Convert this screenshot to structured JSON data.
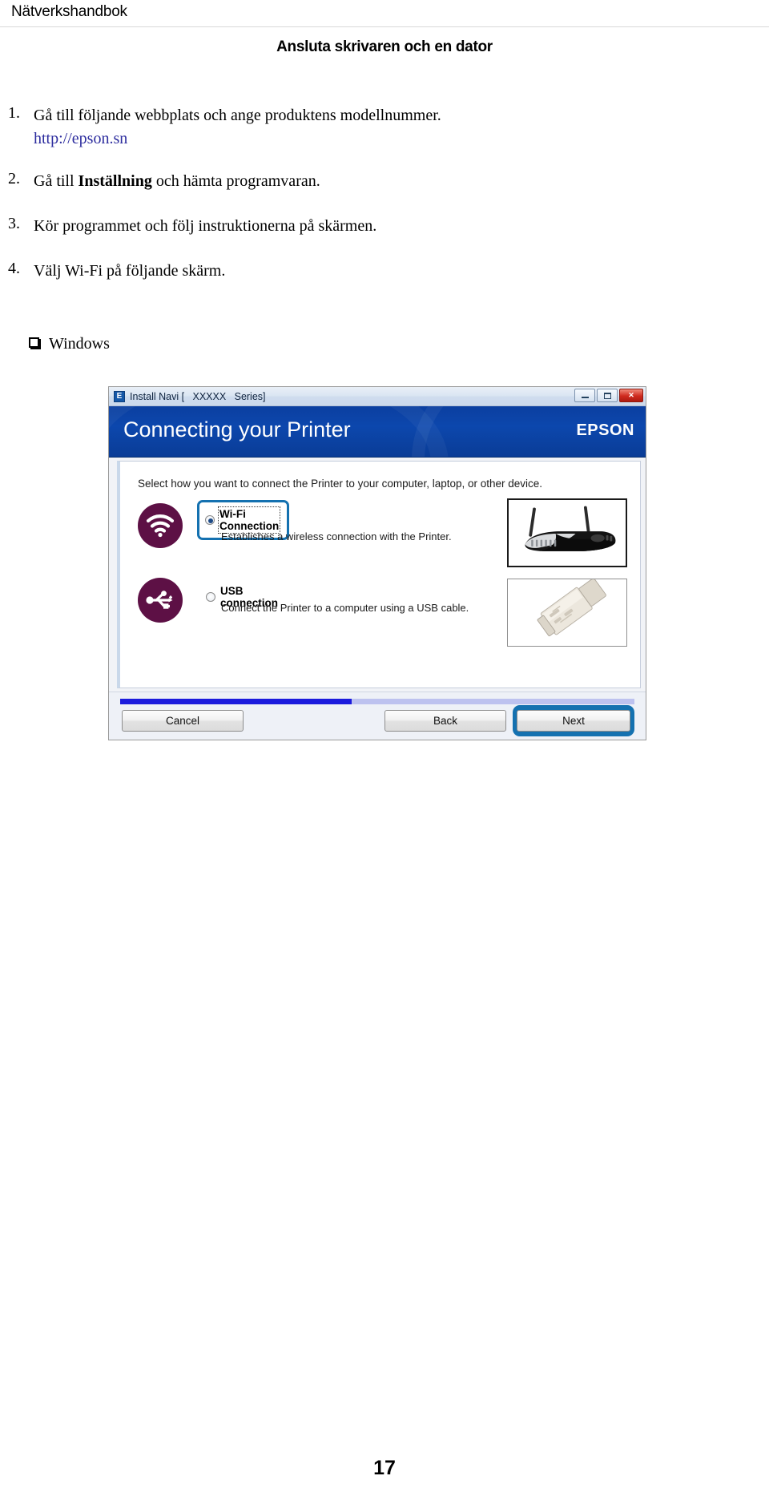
{
  "page": {
    "running_head": "Nätverkshandbok",
    "section_title": "Ansluta skrivaren och en dator",
    "page_number": "17"
  },
  "steps": [
    {
      "num": "1.",
      "text": "Gå till följande webbplats och ange produktens modellnummer.",
      "link": "http://epson.sn"
    },
    {
      "num": "2.",
      "text_before": "Gå till ",
      "bold": "Inställning",
      "text_after": " och hämta programvaran."
    },
    {
      "num": "3.",
      "text": "Kör programmet och följ instruktionerna på skärmen."
    },
    {
      "num": "4.",
      "text": "Välj Wi-Fi på följande skärm."
    }
  ],
  "bullet": {
    "glyph": "square-bullet-icon",
    "label": "Windows"
  },
  "dialog": {
    "titlebar": {
      "app_icon": "E",
      "title": "Install Navi [   XXXXX   Series]",
      "minimize_label": "minimize-icon",
      "maximize_label": "maximize-icon",
      "close_label": "✕"
    },
    "banner": {
      "heading": "Connecting your Printer",
      "brand": "EPSON"
    },
    "content": {
      "intro": "Select how you want to connect the Printer to your computer, laptop, or other device.",
      "options": [
        {
          "id": "wifi",
          "icon": "wifi-icon",
          "label": "Wi-Fi Connection",
          "description": "Establishes a wireless connection with the Printer.",
          "selected": true,
          "focused": true,
          "thumbnail": "wireless-router-image"
        },
        {
          "id": "usb",
          "icon": "usb-icon",
          "label": "USB connection",
          "description": "Connect the Printer to a computer using a USB cable.",
          "selected": false,
          "focused": false,
          "thumbnail": "usb-cable-image"
        }
      ]
    },
    "footer": {
      "progress_percent": 45,
      "cancel_label": "Cancel",
      "back_label": "Back",
      "next_label": "Next"
    }
  },
  "colors": {
    "link": "#2c2c9e",
    "banner_blue": "#0c47ad",
    "icon_plum": "#5d1045",
    "focus_blue": "#1471b0",
    "progress_blue": "#1b1bdd",
    "progress_track": "#bdc2ef"
  }
}
